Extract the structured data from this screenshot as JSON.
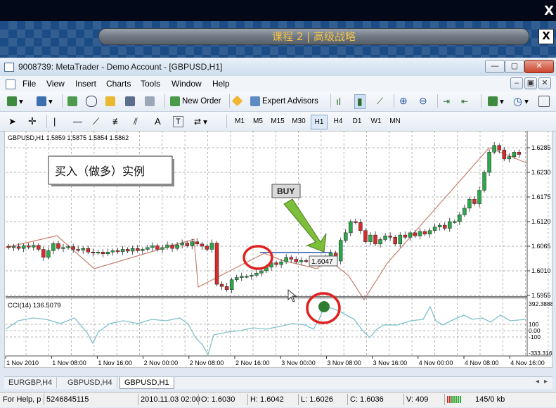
{
  "overlay": {
    "close_label": "X"
  },
  "lesson": {
    "title": "课程 2 | 高级战略",
    "close_label": "X"
  },
  "window": {
    "title": "9008739: MetaTrader - Demo Account - [GBPUSD,H1]",
    "min": "—",
    "max": "▢",
    "close": "✕"
  },
  "menu": {
    "file": "File",
    "view": "View",
    "insert": "Insert",
    "charts": "Charts",
    "tools": "Tools",
    "window": "Window",
    "help": "Help"
  },
  "toolbar": {
    "new_order": "New Order",
    "expert_advisors": "Expert Advisors"
  },
  "draw_tools": {
    "text_tool": "A",
    "label_tool": "T"
  },
  "timeframes": [
    "M1",
    "M5",
    "M15",
    "M30",
    "H1",
    "H4",
    "D1",
    "W1",
    "MN"
  ],
  "chart": {
    "header": "GBPUSD,H1  1.5859 1.5875 1.5854 1.5862",
    "annotation": "买入（做多）实例",
    "buy_label": "BUY",
    "price_tag": "1.6047",
    "price_ticks": [
      "1.6285",
      "1.6230",
      "1.6175",
      "1.6120",
      "1.6065",
      "1.6010",
      "1.5955"
    ],
    "cci_header": "CCI(14) 136.5079",
    "cci_ticks": [
      "392.3888",
      "100",
      "0.00",
      "-100",
      "-333.316"
    ],
    "time_ticks": [
      "1 Nov 2010",
      "1 Nov 08:00",
      "1 Nov 16:00",
      "2 Nov 00:00",
      "2 Nov 08:00",
      "2 Nov 16:00",
      "3 Nov 00:00",
      "3 Nov 08:00",
      "3 Nov 16:00",
      "4 Nov 00:00",
      "4 Nov 08:00",
      "4 Nov 16:00"
    ],
    "colors": {
      "bull": "#2aa84a",
      "bear": "#d42b2b",
      "cci": "#7ec1c9",
      "zigzag": "#c8806e",
      "highlight": "#e02020",
      "arrow": "#7bbf3a"
    }
  },
  "chart_tabs": [
    "EURGBP,H4",
    "GBPUSD,H4",
    "GBPUSD,H1"
  ],
  "status": {
    "help": "For Help, p",
    "num": "5246845115",
    "datetime": "2010.11.03 02:00",
    "open": "O: 1.6030",
    "high": "H: 1.6042",
    "low": "L: 1.6026",
    "close": "C: 1.6036",
    "volume": "V: 409",
    "traffic": "145/0 kb"
  }
}
